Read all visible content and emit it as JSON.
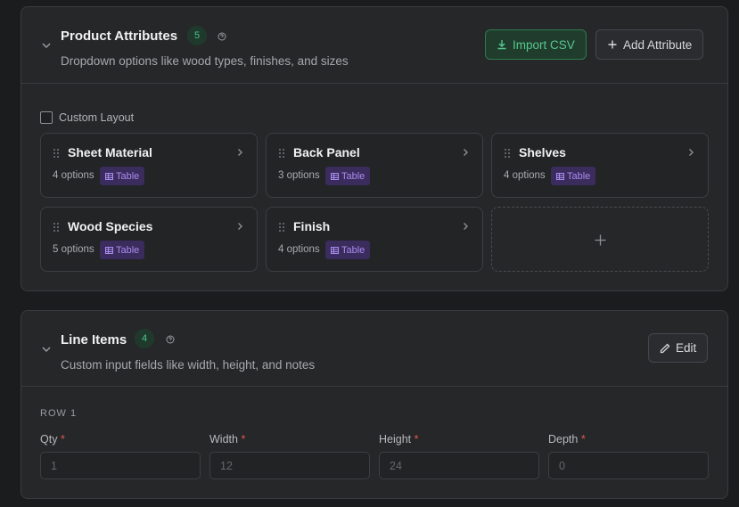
{
  "attributes": {
    "title": "Product Attributes",
    "count": "5",
    "subtitle": "Dropdown options like wood types, finishes, and sizes",
    "import_label": "Import CSV",
    "add_label": "Add Attribute",
    "custom_layout_label": "Custom Layout",
    "items": [
      {
        "name": "Sheet Material",
        "options": "4 options",
        "tag": "Table"
      },
      {
        "name": "Back Panel",
        "options": "3 options",
        "tag": "Table"
      },
      {
        "name": "Shelves",
        "options": "4 options",
        "tag": "Table"
      },
      {
        "name": "Wood Species",
        "options": "5 options",
        "tag": "Table"
      },
      {
        "name": "Finish",
        "options": "4 options",
        "tag": "Table"
      }
    ]
  },
  "line_items": {
    "title": "Line Items",
    "count": "4",
    "subtitle": "Custom input fields like width, height, and notes",
    "edit_label": "Edit",
    "row_label": "ROW 1",
    "required_mark": "*",
    "fields": [
      {
        "label": "Qty",
        "placeholder": "1"
      },
      {
        "label": "Width",
        "placeholder": "12"
      },
      {
        "label": "Height",
        "placeholder": "24"
      },
      {
        "label": "Depth",
        "placeholder": "0"
      }
    ]
  },
  "colors": {
    "accent_green": "#55c98e",
    "tag_purple": "#a98cf0",
    "required_red": "#e0564f"
  }
}
